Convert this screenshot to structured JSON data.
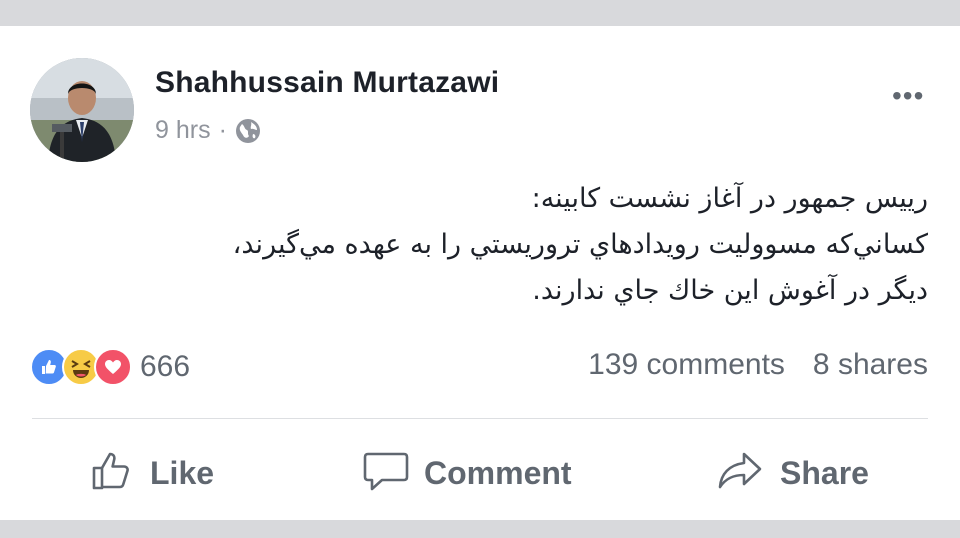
{
  "post": {
    "author": "Shahhussain Murtazawi",
    "time": "9 hrs",
    "separator": "·",
    "privacy_icon": "globe-icon",
    "more_label": "•••",
    "text_lines": [
      "رییس جمهور در آغاز نشست کابینه:",
      "کساني‌که مسوولیت رویدادهاي تروریستي را به عهده مي‌گیرند،",
      "دیگر در آغوش این خاك جاي ندارند."
    ]
  },
  "stats": {
    "reaction_icons": [
      "like-icon",
      "haha-icon",
      "love-icon"
    ],
    "reaction_count": "666",
    "comments": "139 comments",
    "shares": "8 shares"
  },
  "actions": {
    "like": "Like",
    "comment": "Comment",
    "share": "Share"
  },
  "colors": {
    "like_blue": "#4d8cf5",
    "haha_yellow": "#f7cb46",
    "love_red": "#f25268",
    "muted_text": "#606770",
    "band": "#d8d9dc"
  }
}
